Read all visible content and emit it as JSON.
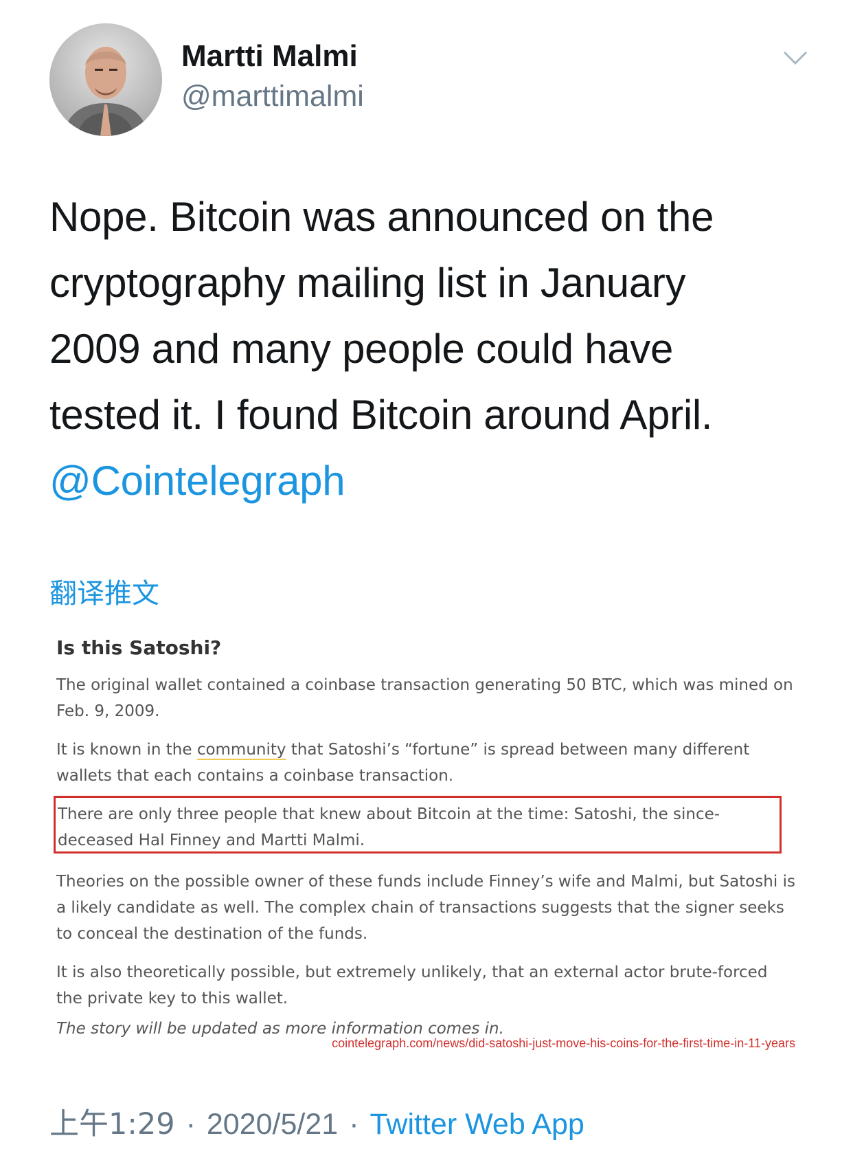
{
  "user": {
    "display_name": "Martti Malmi",
    "handle": "@marttimalmi"
  },
  "tweet": {
    "lines": [
      "Nope. Bitcoin was announced on the",
      "cryptography mailing list in January",
      "2009 and many people could have",
      "tested it. I found Bitcoin around April."
    ],
    "mention": "@Cointelegraph",
    "translate_label": "翻译推文"
  },
  "article": {
    "title": "Is this Satoshi?",
    "p1": "The original wallet contained a coinbase transaction generating 50 BTC, which was mined on Feb. 9, 2009.",
    "p2_before": "It is known in the ",
    "p2_link": "community",
    "p2_after": " that Satoshi’s “fortune” is spread between many different wallets that each contains a coinbase transaction.",
    "p3": "There are only three people that knew about Bitcoin at the time: Satoshi, the since-deceased Hal Finney and Martti Malmi.",
    "p4": "Theories on the possible owner of these funds include Finney’s wife and Malmi, but Satoshi is a likely candidate as well. The complex chain of transactions suggests that the signer seeks to conceal the destination of the funds.",
    "p5": "It is also theoretically possible, but extremely unlikely, that an external actor brute-forced the private key to this wallet.",
    "p6": "The story will be updated as more information comes in.",
    "source_url": "cointelegraph.com/news/did-satoshi-just-move-his-coins-for-the-first-time-in-11-years"
  },
  "footer": {
    "time": "上午1:29",
    "separator": "·",
    "date": "2020/5/21",
    "app": "Twitter Web App"
  },
  "colors": {
    "link": "#1b95e0",
    "muted": "#657786",
    "highlight_border": "#d0312d"
  },
  "icons": {
    "menu": "chevron-down-icon",
    "avatar": "profile-photo"
  }
}
